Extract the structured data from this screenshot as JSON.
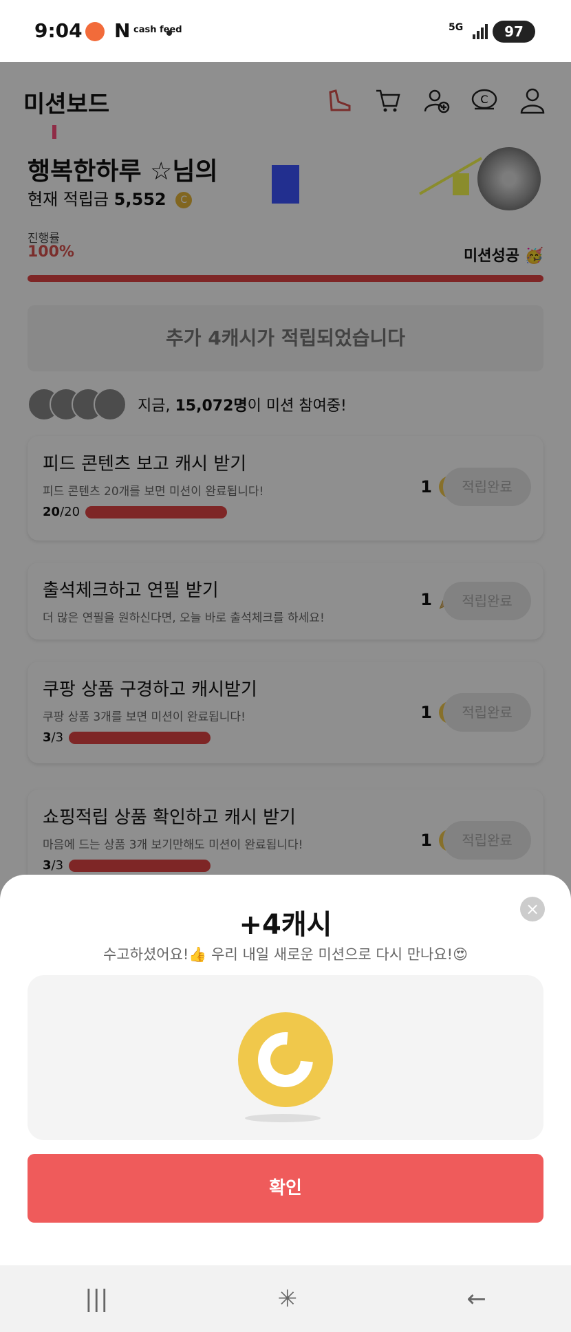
{
  "status_bar": {
    "time": "9:04",
    "app_icon_n": "N",
    "app_icon_cash": "cash feed",
    "network": "5G",
    "battery": "97"
  },
  "header": {
    "title": "미션보드",
    "icons": [
      "shoe-icon",
      "cart-icon",
      "add-friend-icon",
      "cash-icon",
      "profile-icon"
    ]
  },
  "profile": {
    "greeting": "행복한하루 ☆님의",
    "balance_label": "현재 적립금",
    "balance_value": "5,552",
    "coin_symbol": "C"
  },
  "progress": {
    "label": "진행률",
    "value": "100%",
    "fraction": 1.0,
    "status": "미션성공 🥳"
  },
  "banner": {
    "text": "추가 4캐시가 적립되었습니다"
  },
  "participants": {
    "prefix": "지금,",
    "count": "15,072명",
    "suffix": "이 미션 참여중!"
  },
  "missions": [
    {
      "title": "피드 콘텐츠 보고 캐시 받기",
      "subtitle": "피드 콘텐츠 20개를 보면 미션이 완료됩니다!",
      "progress_current": "20",
      "progress_total": "/20",
      "reward": "1",
      "reward_icon": "coin-icon",
      "button": "적립완료"
    },
    {
      "title": "출석체크하고 연필 받기",
      "subtitle": "더 많은 연필을 원하신다면, 오늘 바로 출석체크를 하세요!",
      "reward": "1",
      "reward_icon": "pencil-icon",
      "button": "적립완료"
    },
    {
      "title": "쿠팡 상품 구경하고 캐시받기",
      "subtitle": "쿠팡 상품 3개를 보면 미션이 완료됩니다!",
      "progress_current": "3",
      "progress_total": "/3",
      "reward": "1",
      "reward_icon": "coin-icon",
      "button": "적립완료"
    },
    {
      "title": "쇼핑적립 상품 확인하고 캐시 받기",
      "subtitle": "마음에 드는 상품 3개 보기만해도 미션이 완료됩니다!",
      "progress_current": "3",
      "progress_total": "/3",
      "reward": "1",
      "reward_icon": "coin-icon",
      "button": "적립완료"
    }
  ],
  "modal": {
    "title": "+4캐시",
    "subtitle": "수고하셨어요!👍 우리 내일 새로운 미션으로 다시 만나요!😍",
    "confirm": "확인",
    "close_icon": "close-icon"
  },
  "nav": {
    "recents": "|||",
    "home": "✳",
    "back": "←"
  },
  "colors": {
    "accent_red": "#ef5b5b",
    "coin_gold": "#f0c84b",
    "progress_red": "#e04545"
  }
}
